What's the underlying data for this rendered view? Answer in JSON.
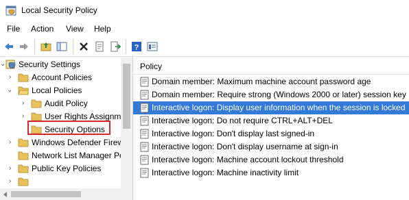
{
  "window": {
    "title": "Local Security Policy"
  },
  "menu": [
    "File",
    "Action",
    "View",
    "Help"
  ],
  "toolbar": {
    "buttons": [
      "back-arrow-icon",
      "forward-arrow-icon",
      "up-folder-icon",
      "show-hide-tree-icon",
      "delete-icon",
      "properties-icon",
      "export-list-icon",
      "help-icon",
      "console-view-icon"
    ]
  },
  "tree": {
    "items": [
      {
        "label": "Security Settings",
        "chevron": "⌵",
        "icon": "shield-settings-icon"
      },
      {
        "label": "Account Policies",
        "chevron": "›",
        "icon": "folder-icon"
      },
      {
        "label": "Local Policies",
        "chevron": "˅",
        "icon": "folder-icon"
      },
      {
        "label": "Audit Policy",
        "chevron": "›",
        "icon": "folder-icon"
      },
      {
        "label": "User Rights Assignme",
        "chevron": "›",
        "icon": "folder-icon"
      },
      {
        "label": "Security Options",
        "chevron": "",
        "icon": "folder-icon"
      },
      {
        "label": "Windows Defender Firew",
        "chevron": "›",
        "icon": "folder-icon"
      },
      {
        "label": "Network List Manager Po",
        "chevron": "",
        "icon": "folder-icon"
      },
      {
        "label": "Public Key Policies",
        "chevron": "›",
        "icon": "folder-icon"
      }
    ]
  },
  "list": {
    "column_header": "Policy",
    "rows": [
      {
        "label": "Domain member: Maximum machine account password age",
        "selected": false
      },
      {
        "label": "Domain member: Require strong (Windows 2000 or later) session key",
        "selected": false
      },
      {
        "label": "Interactive logon: Display user information when the session is locked",
        "selected": true
      },
      {
        "label": "Interactive logon: Do not require CTRL+ALT+DEL",
        "selected": false
      },
      {
        "label": "Interactive logon: Don't display last signed-in",
        "selected": false
      },
      {
        "label": "Interactive logon: Don't display username at sign-in",
        "selected": false
      },
      {
        "label": "Interactive logon: Machine account lockout threshold",
        "selected": false
      },
      {
        "label": "Interactive logon: Machine inactivity limit",
        "selected": false
      }
    ]
  },
  "colors": {
    "selection": "#3379d6",
    "highlight_box": "#d7262c",
    "folder": "#e8c15a"
  }
}
